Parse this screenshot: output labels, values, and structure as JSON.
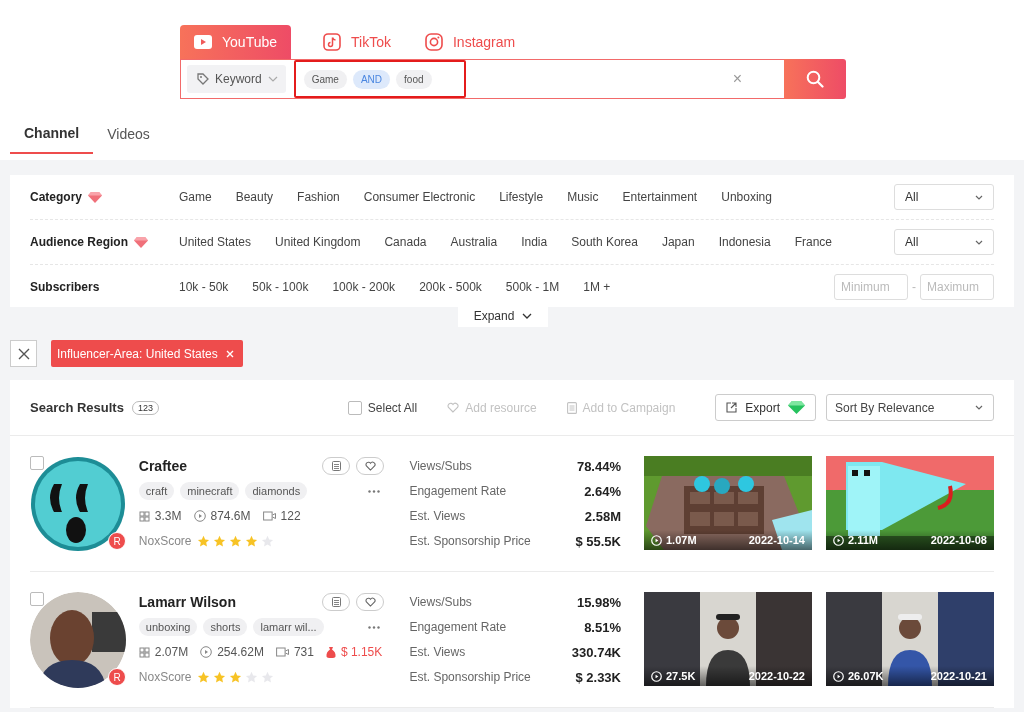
{
  "platforms": [
    {
      "label": "YouTube",
      "selected": true
    },
    {
      "label": "TikTok",
      "selected": false
    },
    {
      "label": "Instagram",
      "selected": false
    }
  ],
  "search": {
    "mode": "Keyword",
    "terms": [
      {
        "text": "Game",
        "kind": "term"
      },
      {
        "text": "AND",
        "kind": "operator"
      },
      {
        "text": "food",
        "kind": "term"
      }
    ],
    "clear": "×"
  },
  "view_tabs": [
    {
      "label": "Channel",
      "selected": true
    },
    {
      "label": "Videos",
      "selected": false
    }
  ],
  "filters": [
    {
      "label": "Category",
      "premium": true,
      "kind": "options",
      "options": [
        "Game",
        "Beauty",
        "Fashion",
        "Consumer Electronic",
        "Lifestyle",
        "Music",
        "Entertainment",
        "Unboxing"
      ],
      "select": "All"
    },
    {
      "label": "Audience Region",
      "premium": true,
      "kind": "options",
      "options": [
        "United States",
        "United Kingdom",
        "Canada",
        "Australia",
        "India",
        "South Korea",
        "Japan",
        "Indonesia",
        "France"
      ],
      "select": "All"
    },
    {
      "label": "Subscribers",
      "premium": false,
      "kind": "range",
      "options": [
        "10k - 50k",
        "50k - 100k",
        "100k - 200k",
        "200k - 500k",
        "500k - 1M",
        "1M +"
      ],
      "min_placeholder": "Minimum",
      "separator": "-",
      "max_placeholder": "Maximum"
    }
  ],
  "expand": "Expand",
  "active_filters": [
    {
      "label": "Influencer-Area: United States"
    }
  ],
  "results": {
    "title": "Search Results",
    "count": "123",
    "select_all": {
      "label": "Select All",
      "checked": false
    },
    "actions": [
      {
        "label": "Add resource",
        "disabled": true
      },
      {
        "label": "Add to Campaign",
        "disabled": true
      }
    ],
    "export": "Export",
    "sort": "Sort By Relevance"
  },
  "channels": [
    {
      "name": "Craftee",
      "checked": false,
      "badge": "R",
      "tags": [
        "craft",
        "minecraft",
        "diamonds"
      ],
      "subscribers": "3.3M",
      "views": "874.6M",
      "videos": "122",
      "score_label": "NoxScore",
      "stars": 4,
      "metrics": [
        {
          "label": "Views/Subs",
          "value": "78.44%"
        },
        {
          "label": "Engagement Rate",
          "value": "2.64%"
        },
        {
          "label": "Est. Views",
          "value": "2.58M"
        },
        {
          "label": "Est. Sponsorship Price",
          "value": "$ 55.5K"
        }
      ],
      "recent_videos": [
        {
          "views": "1.07M",
          "date": "2022-10-14"
        },
        {
          "views": "2.11M",
          "date": "2022-10-08"
        }
      ]
    },
    {
      "name": "Lamarr Wilson",
      "checked": false,
      "badge": "R",
      "tags": [
        "unboxing",
        "shorts",
        "lamarr wil..."
      ],
      "subscribers": "2.07M",
      "views": "254.62M",
      "videos": "731",
      "price": "$ 1.15K",
      "score_label": "NoxScore",
      "stars": 3,
      "metrics": [
        {
          "label": "Views/Subs",
          "value": "15.98%"
        },
        {
          "label": "Engagement Rate",
          "value": "8.51%"
        },
        {
          "label": "Est. Views",
          "value": "330.74K"
        },
        {
          "label": "Est. Sponsorship Price",
          "value": "$ 2.33K"
        }
      ],
      "recent_videos": [
        {
          "views": "27.5K",
          "date": "2022-10-22"
        },
        {
          "views": "26.07K",
          "date": "2022-10-21"
        }
      ]
    }
  ]
}
